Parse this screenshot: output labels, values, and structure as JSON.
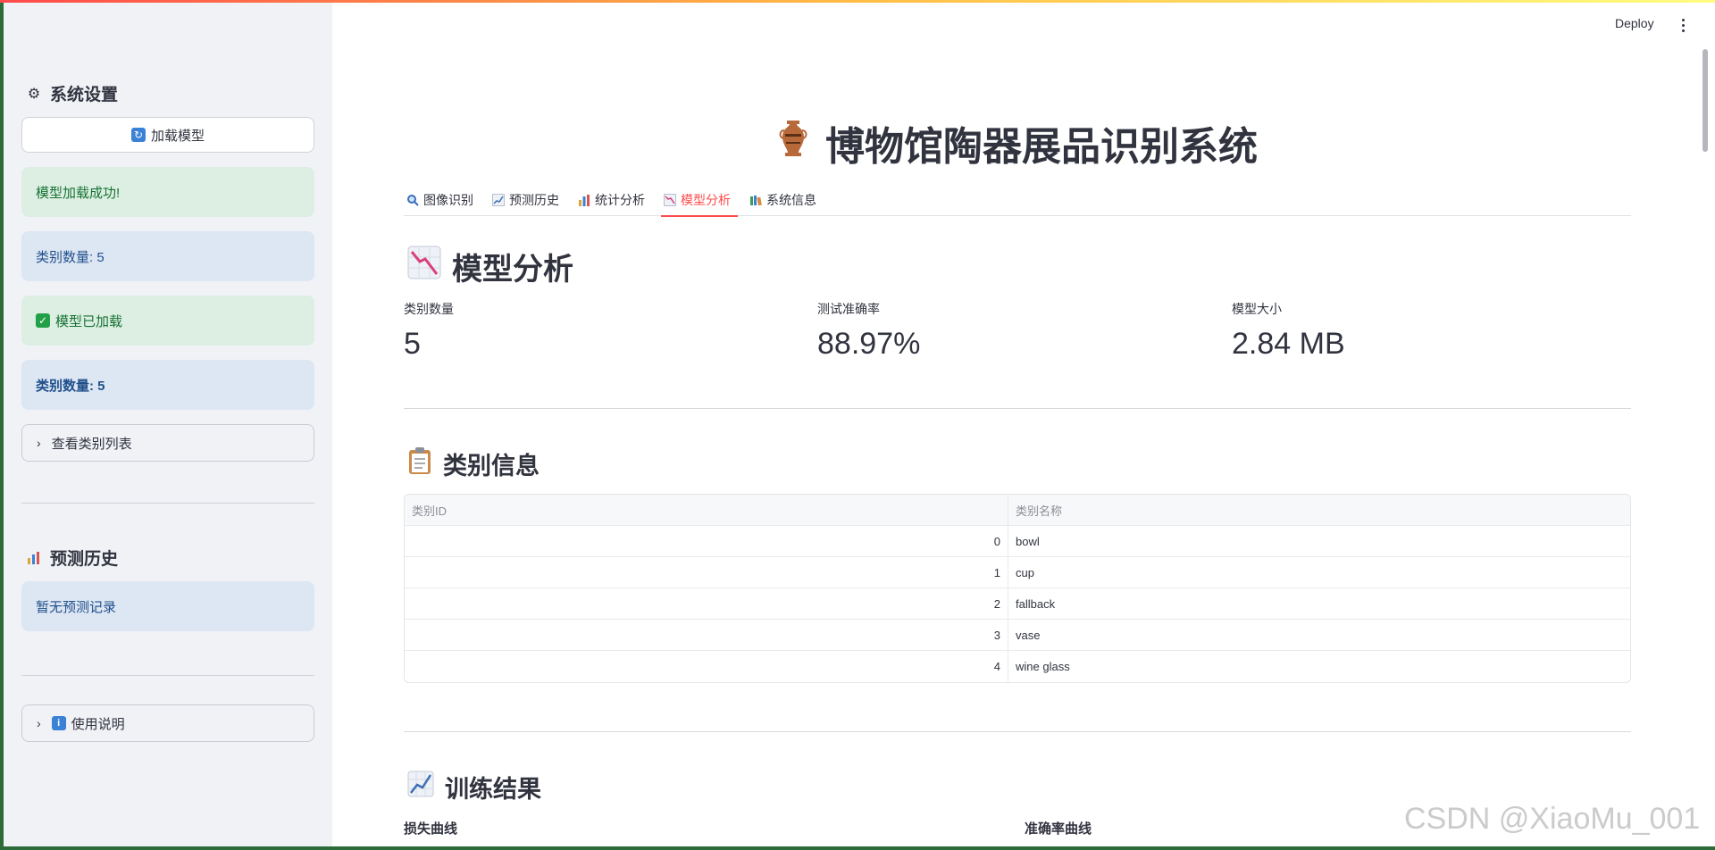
{
  "sidebar": {
    "settings_heading": "系统设置",
    "load_model_button": "加载模型",
    "load_success": "模型加载成功!",
    "class_count_1": "类别数量: 5",
    "model_loaded": "模型已加载",
    "class_count_2": "类别数量: 5",
    "view_classes": "查看类别列表",
    "history_heading": "预测历史",
    "no_history": "暂无预测记录",
    "usage": "使用说明"
  },
  "header": {
    "deploy_label": "Deploy"
  },
  "main": {
    "title": "博物馆陶器展品识别系统",
    "tabs": [
      {
        "label": "图像识别",
        "icon": "magnifier-icon"
      },
      {
        "label": "预测历史",
        "icon": "chart-increasing-icon"
      },
      {
        "label": "统计分析",
        "icon": "bar-chart-icon"
      },
      {
        "label": "模型分析",
        "icon": "chart-decreasing-icon",
        "active": true
      },
      {
        "label": "系统信息",
        "icon": "books-icon"
      }
    ],
    "model_section": "模型分析",
    "metrics": [
      {
        "label": "类别数量",
        "value": "5"
      },
      {
        "label": "测试准确率",
        "value": "88.97%"
      },
      {
        "label": "模型大小",
        "value": "2.84 MB"
      }
    ],
    "class_section": "类别信息",
    "table": {
      "headers": [
        "类别ID",
        "类别名称"
      ],
      "rows": [
        [
          "0",
          "bowl"
        ],
        [
          "1",
          "cup"
        ],
        [
          "2",
          "fallback"
        ],
        [
          "3",
          "vase"
        ],
        [
          "4",
          "wine glass"
        ]
      ]
    },
    "training_section": "训练结果",
    "loss_curve": "损失曲线",
    "accuracy_curve": "准确率曲线"
  },
  "watermark": "CSDN @XiaoMu_001",
  "colors": {
    "accent": "#ff4b4b",
    "success_bg": "#dcefe2",
    "info_bg": "#dde6f3",
    "sidebar_bg": "#f0f2f6"
  }
}
